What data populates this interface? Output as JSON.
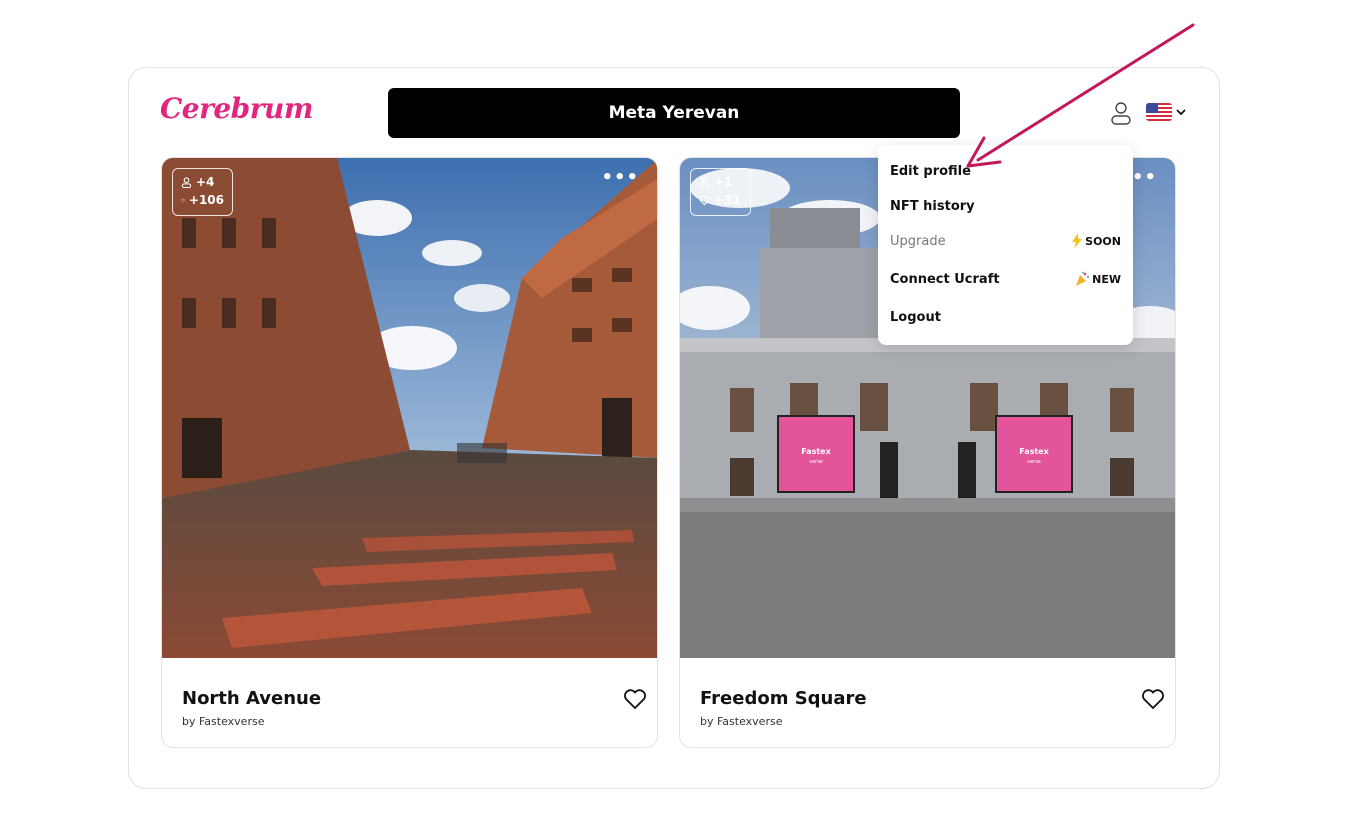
{
  "header": {
    "logo": "Cerebrum",
    "title": "Meta Yerevan",
    "user_icon": "user-icon",
    "language_flag": "us-flag-icon"
  },
  "cards": [
    {
      "name": "North Avenue",
      "author": "by Fastexverse",
      "users": "+4",
      "likes": "+106"
    },
    {
      "name": "Freedom Square",
      "author": "by Fastexverse",
      "users": "+1",
      "likes": "+31",
      "billboard_text": "Fastex",
      "billboard_sub": "verse"
    }
  ],
  "menu": {
    "items": [
      {
        "label": "Edit profile"
      },
      {
        "label": "NFT history"
      },
      {
        "label": "Upgrade",
        "badge": "SOON",
        "badge_icon": "lightning-icon"
      },
      {
        "label": "Connect Ucraft",
        "badge": "NEW",
        "badge_icon": "party-popper-icon"
      },
      {
        "label": "Logout"
      }
    ]
  },
  "colors": {
    "brand": "#e2267f",
    "annotation_arrow": "#c2185b",
    "billboard": "#e4549a"
  }
}
